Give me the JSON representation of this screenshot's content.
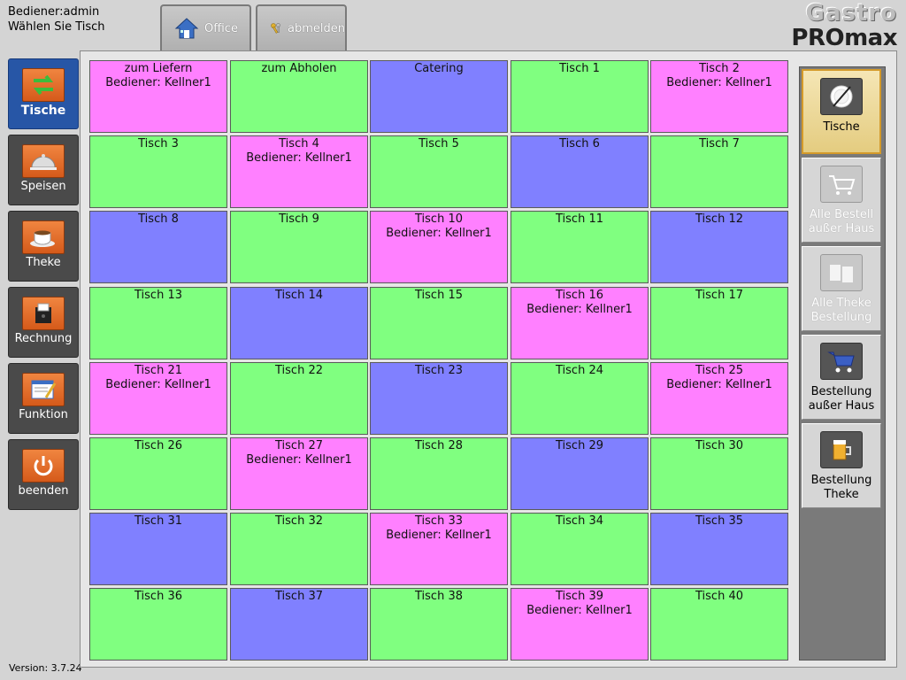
{
  "header": {
    "user": "Bediener:admin",
    "hint": "Wählen Sie Tisch",
    "office_label": "Office",
    "logout_label": "abmelden",
    "logo_top": "Gastro",
    "logo_bottom": "PROmax"
  },
  "version": "Version: 3.7.24",
  "nav": [
    {
      "label": "Tische"
    },
    {
      "label": "Speisen"
    },
    {
      "label": "Theke"
    },
    {
      "label": "Rechnung"
    },
    {
      "label": "Funktion"
    },
    {
      "label": "beenden"
    }
  ],
  "tables": [
    {
      "name": "zum Liefern",
      "waiter": "Bediener: Kellner1",
      "status": "busy"
    },
    {
      "name": "zum Abholen",
      "waiter": "",
      "status": "free"
    },
    {
      "name": "Catering",
      "waiter": "",
      "status": "reserved"
    },
    {
      "name": "Tisch 1",
      "waiter": "",
      "status": "free"
    },
    {
      "name": "Tisch 2",
      "waiter": "Bediener: Kellner1",
      "status": "busy"
    },
    {
      "name": "Tisch 3",
      "waiter": "",
      "status": "free"
    },
    {
      "name": "Tisch 4",
      "waiter": "Bediener: Kellner1",
      "status": "busy"
    },
    {
      "name": "Tisch 5",
      "waiter": "",
      "status": "free"
    },
    {
      "name": "Tisch 6",
      "waiter": "",
      "status": "reserved"
    },
    {
      "name": "Tisch 7",
      "waiter": "",
      "status": "free"
    },
    {
      "name": "Tisch 8",
      "waiter": "",
      "status": "reserved"
    },
    {
      "name": "Tisch 9",
      "waiter": "",
      "status": "free"
    },
    {
      "name": "Tisch 10",
      "waiter": "Bediener: Kellner1",
      "status": "busy"
    },
    {
      "name": "Tisch 11",
      "waiter": "",
      "status": "free"
    },
    {
      "name": "Tisch 12",
      "waiter": "",
      "status": "reserved"
    },
    {
      "name": "Tisch 13",
      "waiter": "",
      "status": "free"
    },
    {
      "name": "Tisch 14",
      "waiter": "",
      "status": "reserved"
    },
    {
      "name": "Tisch 15",
      "waiter": "",
      "status": "free"
    },
    {
      "name": "Tisch 16",
      "waiter": "Bediener: Kellner1",
      "status": "busy"
    },
    {
      "name": "Tisch 17",
      "waiter": "",
      "status": "free"
    },
    {
      "name": "Tisch 21",
      "waiter": "Bediener: Kellner1",
      "status": "busy"
    },
    {
      "name": "Tisch 22",
      "waiter": "",
      "status": "free"
    },
    {
      "name": "Tisch 23",
      "waiter": "",
      "status": "reserved"
    },
    {
      "name": "Tisch 24",
      "waiter": "",
      "status": "free"
    },
    {
      "name": "Tisch 25",
      "waiter": "Bediener: Kellner1",
      "status": "busy"
    },
    {
      "name": "Tisch 26",
      "waiter": "",
      "status": "free"
    },
    {
      "name": "Tisch 27",
      "waiter": "Bediener: Kellner1",
      "status": "busy"
    },
    {
      "name": "Tisch 28",
      "waiter": "",
      "status": "free"
    },
    {
      "name": "Tisch 29",
      "waiter": "",
      "status": "reserved"
    },
    {
      "name": "Tisch 30",
      "waiter": "",
      "status": "free"
    },
    {
      "name": "Tisch 31",
      "waiter": "",
      "status": "reserved"
    },
    {
      "name": "Tisch 32",
      "waiter": "",
      "status": "free"
    },
    {
      "name": "Tisch 33",
      "waiter": "Bediener: Kellner1",
      "status": "busy"
    },
    {
      "name": "Tisch 34",
      "waiter": "",
      "status": "free"
    },
    {
      "name": "Tisch 35",
      "waiter": "",
      "status": "reserved"
    },
    {
      "name": "Tisch 36",
      "waiter": "",
      "status": "free"
    },
    {
      "name": "Tisch 37",
      "waiter": "",
      "status": "reserved"
    },
    {
      "name": "Tisch 38",
      "waiter": "",
      "status": "free"
    },
    {
      "name": "Tisch 39",
      "waiter": "Bediener: Kellner1",
      "status": "busy"
    },
    {
      "name": "Tisch 40",
      "waiter": "",
      "status": "free"
    }
  ],
  "right_panel": [
    {
      "l1": "Tische",
      "l2": ""
    },
    {
      "l1": "Alle Bestell",
      "l2": "außer Haus"
    },
    {
      "l1": "Alle Theke",
      "l2": "Bestellung"
    },
    {
      "l1": "Bestellung",
      "l2": "außer Haus"
    },
    {
      "l1": "Bestellung",
      "l2": "Theke"
    }
  ],
  "colors": {
    "free": "#80ff80",
    "busy": "#ff80ff",
    "reserved": "#8080ff",
    "nav_active": "#2756a6",
    "accent": "#e8742c"
  }
}
